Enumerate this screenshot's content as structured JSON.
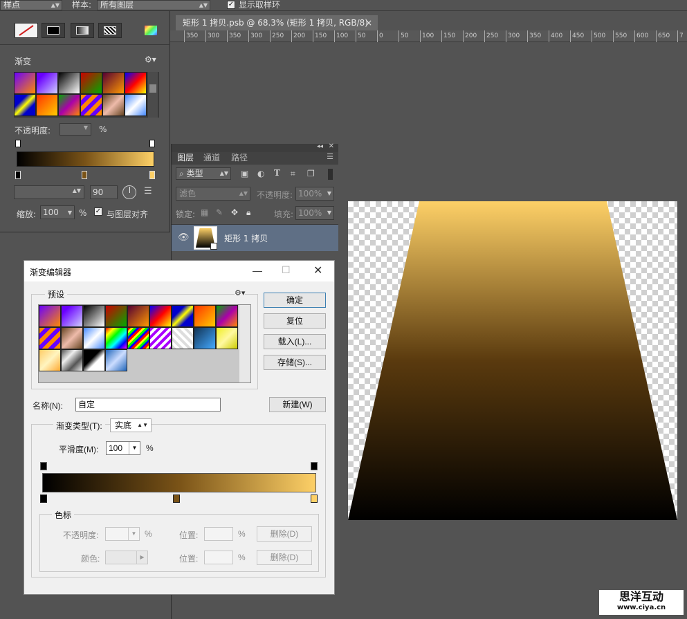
{
  "options_bar": {
    "point_sample": "样点",
    "sample_label": "样本:",
    "sample_value": "所有图层",
    "show_ring_label": "显示取样环",
    "show_ring_checked": true
  },
  "document": {
    "tab_title": "矩形 1 拷贝.psb @ 68.3% (矩形 1 拷贝, RGB/8)",
    "close_glyph": "×",
    "ruler_ticks": [
      "350",
      "300",
      "350",
      "300",
      "250",
      "200",
      "150",
      "100",
      "50",
      "0",
      "50",
      "100",
      "150",
      "200",
      "250",
      "300",
      "350",
      "400",
      "450",
      "500",
      "550",
      "600",
      "650",
      "7"
    ]
  },
  "gradient_panel": {
    "title": "渐变",
    "opacity_label": "不透明度:",
    "percent": "%",
    "angle_value": "90",
    "scale_label": "缩放:",
    "scale_value": "100",
    "align_label": "与图层对齐",
    "align_checked": true
  },
  "layers_panel": {
    "tabs": [
      "图层",
      "通道",
      "路径"
    ],
    "filter_label": "类型",
    "blend_mode": "滤色",
    "opacity_label": "不透明度:",
    "opacity_value": "100%",
    "lock_label": "锁定:",
    "fill_label": "填充:",
    "fill_value": "100%",
    "layer_name": "矩形 1 拷贝"
  },
  "gradient_editor": {
    "title": "渐变编辑器",
    "presets_label": "预设",
    "ok": "确定",
    "reset": "复位",
    "load": "载入(L)...",
    "save": "存储(S)...",
    "name_label": "名称(N):",
    "name_value": "自定",
    "new": "新建(W)",
    "type_label": "渐变类型(T):",
    "type_value": "实底",
    "smooth_label": "平滑度(M):",
    "smooth_value": "100",
    "percent": "%",
    "stops_label": "色标",
    "opacity_label": "不透明度:",
    "location_label": "位置:",
    "delete": "删除(D)",
    "color_label": "颜色:"
  },
  "gradient_colors": {
    "dark": "#000000",
    "mid": "#7a5317",
    "light": "#fdd067"
  },
  "watermark": {
    "line1": "思洋互动",
    "line2": "www.ciya.cn"
  }
}
